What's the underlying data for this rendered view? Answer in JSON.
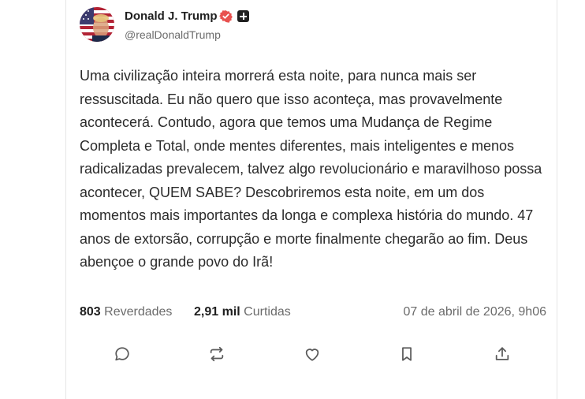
{
  "author": {
    "name": "Donald J. Trump",
    "handle": "@realDonaldTrump"
  },
  "post": {
    "text": "Uma civilização inteira morrerá esta noite, para nunca mais ser ressuscitada. Eu não quero que isso aconteça, mas provavelmente acontecerá. Contudo, agora que temos uma Mudança de Regime Completa e Total, onde mentes diferentes, mais inteligentes e menos radicalizadas prevalecem, talvez algo revolucionário e maravilhoso possa acontecer, QUEM SABE? Descobriremos esta noite, em um dos momentos mais importantes da longa e complexa história do mundo. 47 anos de extorsão, corrupção e morte finalmente chegarão ao fim. Deus abençoe o grande povo do Irã!"
  },
  "stats": {
    "reposts_count": "803",
    "reposts_label": "Reverdades",
    "likes_count": "2,91 mil",
    "likes_label": "Curtidas",
    "timestamp": "07 de abril de 2026, 9h06"
  },
  "actions": {
    "icons": [
      "reply-icon",
      "repost-icon",
      "like-icon",
      "bookmark-icon",
      "share-icon"
    ]
  },
  "colors": {
    "verified_badge": "#e8514f",
    "text": "#2b2b2b",
    "muted": "#6b6b6b"
  }
}
